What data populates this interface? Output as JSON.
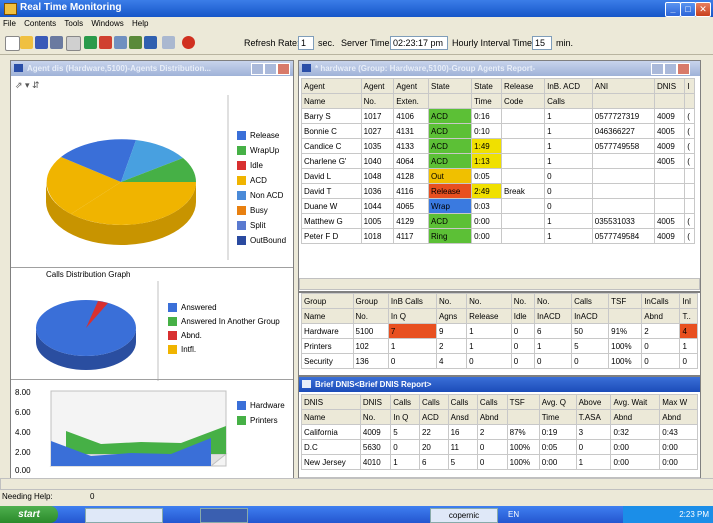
{
  "app": {
    "title": "Real Time Monitoring"
  },
  "menu": [
    "File",
    "Contents",
    "Tools",
    "Windows",
    "Help"
  ],
  "toolbar": {
    "refresh_label": "Refresh Rate:",
    "refresh_value": "1",
    "refresh_unit": "sec.",
    "server_label": "Server Time:",
    "server_value": "02:23:17 pm",
    "interval_label": "Hourly Interval Time:",
    "interval_value": "15",
    "interval_unit": "min."
  },
  "agent_dist": {
    "title": "Agent dis  (Hardware,5100)-Agents Distribution...",
    "legend": [
      {
        "label": "Release",
        "color": "#3a6fd8"
      },
      {
        "label": "WrapUp",
        "color": "#46b046"
      },
      {
        "label": "Idle",
        "color": "#d83030"
      },
      {
        "label": "ACD",
        "color": "#f0b400"
      },
      {
        "label": "Non ACD",
        "color": "#4a8ad8"
      },
      {
        "label": "Busy",
        "color": "#e88010"
      },
      {
        "label": "Split",
        "color": "#5a7ad0"
      },
      {
        "label": "OutBound",
        "color": "#2a4aa0"
      }
    ]
  },
  "calls_graph": {
    "title": "Calls Distribution Graph",
    "legend": [
      {
        "label": "Answered",
        "color": "#3a6fd8"
      },
      {
        "label": "Answered In Another Group",
        "color": "#46b046"
      },
      {
        "label": "Abnd.",
        "color": "#d83030"
      },
      {
        "label": "Intfl.",
        "color": "#f0b400"
      }
    ]
  },
  "area_chart": {
    "y_ticks": [
      "8.00",
      "6.00",
      "4.00",
      "2.00",
      "0.00"
    ],
    "legend": [
      {
        "label": "Hardware",
        "color": "#3a6fd8"
      },
      {
        "label": "Printers",
        "color": "#46b046"
      }
    ]
  },
  "agents_report": {
    "title": "* hardware  (Group: Hardware,5100)-Group Agents Report-",
    "headers": [
      [
        "Agent",
        "Agent",
        "Agent",
        "State",
        "State",
        "Release",
        "InB. ACD",
        "ANI",
        "DNIS",
        "I"
      ],
      [
        "Name",
        "No.",
        "Exten.",
        "",
        "Time",
        "Code",
        "Calls",
        "",
        "",
        ""
      ]
    ],
    "rows": [
      {
        "name": "Barry S",
        "no": "1017",
        "ext": "4106",
        "state": "ACD",
        "time": "0:16",
        "code": "",
        "calls": "1",
        "ani": "0577727319",
        "dnis": "4009",
        "x": "("
      },
      {
        "name": "Bonnie C",
        "no": "1027",
        "ext": "4131",
        "state": "ACD",
        "time": "0:10",
        "code": "",
        "calls": "1",
        "ani": "046366227",
        "dnis": "4005",
        "x": "("
      },
      {
        "name": "Candice C",
        "no": "1035",
        "ext": "4133",
        "state": "ACD",
        "time": "1:49",
        "code": "",
        "calls": "1",
        "ani": "0577749558",
        "dnis": "4009",
        "x": "("
      },
      {
        "name": "Charlene G'",
        "no": "1040",
        "ext": "4064",
        "state": "ACD",
        "time": "1:13",
        "code": "",
        "calls": "1",
        "ani": "",
        "dnis": "4005",
        "x": "("
      },
      {
        "name": "David L",
        "no": "1048",
        "ext": "4128",
        "state": "Out",
        "time": "0:05",
        "code": "",
        "calls": "0",
        "ani": "",
        "dnis": "",
        "x": ""
      },
      {
        "name": "David T",
        "no": "1036",
        "ext": "4116",
        "state": "Release",
        "time": "2:49",
        "code": "Break",
        "calls": "0",
        "ani": "",
        "dnis": "",
        "x": ""
      },
      {
        "name": "Duane W",
        "no": "1044",
        "ext": "4065",
        "state": "Wrap",
        "time": "0:03",
        "code": "",
        "calls": "0",
        "ani": "",
        "dnis": "",
        "x": ""
      },
      {
        "name": "Matthew G",
        "no": "1005",
        "ext": "4129",
        "state": "ACD",
        "time": "0:00",
        "code": "",
        "calls": "1",
        "ani": "035531033",
        "dnis": "4005",
        "x": "("
      },
      {
        "name": "Peter F D",
        "no": "1018",
        "ext": "4117",
        "state": "Ring",
        "time": "0:00",
        "code": "",
        "calls": "1",
        "ani": "0577749584",
        "dnis": "4009",
        "x": "("
      }
    ],
    "state_colors": {
      "ACD": "#5cc036",
      "Out": "#f0c000",
      "Release": "#e85020",
      "Wrap": "#3a7ae0",
      "Ring": "#5cc036"
    },
    "time_colors": {
      "1:49": "#f0e000",
      "1:13": "#f0e000",
      "2:49": "#f0e000"
    }
  },
  "group_table": {
    "headers": [
      [
        "Group",
        "Group",
        "InB Calls",
        "No.",
        "No.",
        "No.",
        "No.",
        "Calls",
        "TSF",
        "InCalls",
        "Inl"
      ],
      [
        "Name",
        "No.",
        "In Q",
        "Agns",
        "Release",
        "Idle",
        "InACD",
        "InACD",
        "",
        "Abnd",
        "T.."
      ]
    ],
    "rows": [
      [
        "Hardware",
        "5100",
        "7",
        "9",
        "1",
        "0",
        "6",
        "50",
        "91%",
        "2",
        "4"
      ],
      [
        "Printers",
        "102",
        "1",
        "2",
        "1",
        "0",
        "1",
        "5",
        "100%",
        "0",
        "1"
      ],
      [
        "Security",
        "136",
        "0",
        "4",
        "0",
        "0",
        "0",
        "0",
        "100%",
        "0",
        "0"
      ]
    ]
  },
  "dnis_report": {
    "title": "Brief DNIS<Brief DNIS Report>",
    "headers": [
      [
        "DNIS",
        "DNIS",
        "Calls",
        "Calls",
        "Calls",
        "Calls",
        "TSF",
        "Avg. Q",
        "Above",
        "Avg. Wait",
        "Max W"
      ],
      [
        "Name",
        "No.",
        "In Q",
        "ACD",
        "Ansd",
        "Abnd",
        "",
        "Time",
        "T.ASA",
        "Abnd",
        "Abnd"
      ]
    ],
    "rows": [
      [
        "California",
        "4009",
        "5",
        "22",
        "16",
        "2",
        "87%",
        "0:19",
        "3",
        "0:32",
        "0:43"
      ],
      [
        "D.C",
        "5630",
        "0",
        "20",
        "11",
        "0",
        "100%",
        "0:05",
        "0",
        "0:00",
        "0:00"
      ],
      [
        "New Jersey",
        "4010",
        "1",
        "6",
        "5",
        "0",
        "100%",
        "0:00",
        "1",
        "0:00",
        "0:00"
      ]
    ]
  },
  "status_bar": {
    "label": "Needing Help:",
    "value": "0"
  },
  "taskbar": {
    "start": "start",
    "task_copernic": "copernic",
    "lang": "EN",
    "clock": "2:23 PM"
  }
}
